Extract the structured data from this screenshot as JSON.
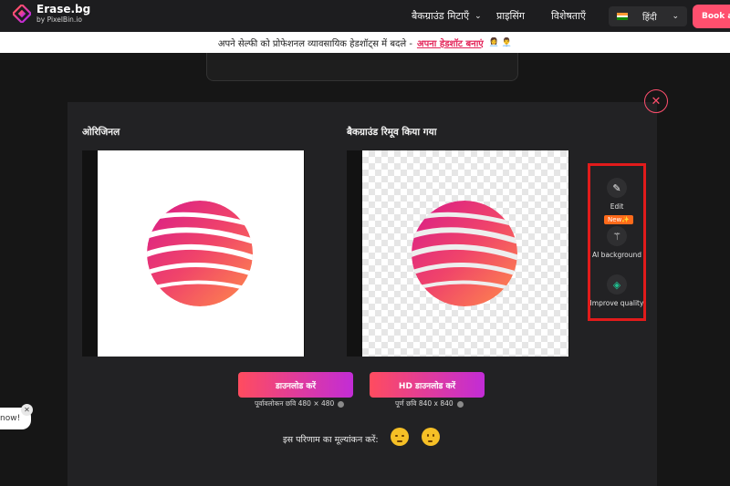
{
  "header": {
    "logo_name": "Erase.bg",
    "logo_sub": "by PixelBin.io",
    "nav_remove": "बैकग्राउंड मिटाएँ",
    "nav_pricing": "प्राइसिंग",
    "nav_features": "विशेषताएँ",
    "language": "हिंदी",
    "book_button": "Book a D"
  },
  "banner": {
    "text": "अपने सेल्फी को प्रोफेशनल व्यावसायिक हेडशॉट्स में बदले -",
    "link": "अपना हेडशॉट बनाएं",
    "emoji": "👩‍💼 👨‍💼"
  },
  "modal": {
    "original_title": "ओरिजिनल",
    "result_title": "बैकग्राउंड रिमूव किया गया",
    "tools": {
      "edit": "Edit",
      "new_badge": "New✨",
      "ai_background": "AI background",
      "improve_quality": "Improve quality"
    },
    "download_label": "डाउनलोड करें",
    "download_caption": "पूर्वावलोकन छवि 480 × 480",
    "hd_download_label": "HD डाउनलोड करें",
    "hd_caption": "पूर्ण छवि 840 x 840",
    "rate_text": "इस परिणाम का मूल्यांकन करें:"
  },
  "chat": {
    "text": "now!",
    "close": "✕"
  },
  "colors": {
    "accent": "#ff4f6e",
    "highlight_box": "#e11b1b",
    "badge": "#ff6a1a"
  }
}
